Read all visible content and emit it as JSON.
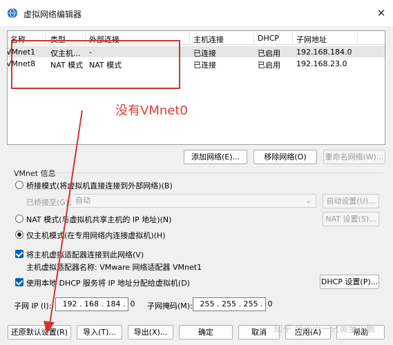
{
  "window": {
    "title": "虚拟网络编辑器",
    "close_icon": "close-icon"
  },
  "network_table": {
    "columns": [
      "名称",
      "类型",
      "外部连接",
      "主机连接",
      "DHCP",
      "子网地址"
    ],
    "rows": [
      {
        "name": "VMnet1",
        "type": "仅主机...",
        "external": "-",
        "host": "已连接",
        "dhcp": "已启用",
        "subnet": "192.168.184.0"
      },
      {
        "name": "VMnet8",
        "type": "NAT 模式",
        "external": "NAT 模式",
        "host": "已连接",
        "dhcp": "已启用",
        "subnet": "192.168.23.0"
      }
    ]
  },
  "annotation": {
    "text": "没有VMnet0",
    "color": "#e23a3a"
  },
  "list_buttons": {
    "add": "添加网络(E)...",
    "remove": "移除网络(O)",
    "rename": "重命名网络(W)..."
  },
  "vmnet_info": {
    "group_title": "VMnet 信息",
    "bridged": "桥接模式(将虚拟机直接连接到外部网络)(B)",
    "bridged_to_label": "已桥接至(G):",
    "bridged_to_value": "自动",
    "auto_settings": "自动设置(U)...",
    "nat": "NAT 模式(与虚拟机共享主机的 IP 地址)(N)",
    "nat_settings": "NAT 设置(S)...",
    "host_only": "仅主机模式(在专用网络内连接虚拟机)(H)",
    "connect_adapter": "将主机虚拟适配器连接到此网络(V)",
    "adapter_name": "主机虚拟适配器名称: VMware 网络适配器 VMnet1",
    "use_dhcp": "使用本地 DHCP 服务将 IP 地址分配给虚拟机(D)",
    "dhcp_settings": "DHCP 设置(P)...",
    "subnet_ip_label": "子网 IP (I):",
    "subnet_ip": " 192 . 168 . 184 .  0",
    "subnet_mask_label": "子网掩码(M):",
    "subnet_mask": " 255 . 255 . 255 .  0"
  },
  "footer": {
    "restore": "还原默认设置(R)",
    "import": "导入(T)...",
    "export": "导出(X)...",
    "ok": "确定",
    "cancel": "取消",
    "apply": "应用(A)",
    "help": "帮助"
  },
  "watermark": "知乎 @小小一只黄金小鹏",
  "colors": {
    "accent": "#005fb8",
    "annotation_red": "#d3302f"
  }
}
